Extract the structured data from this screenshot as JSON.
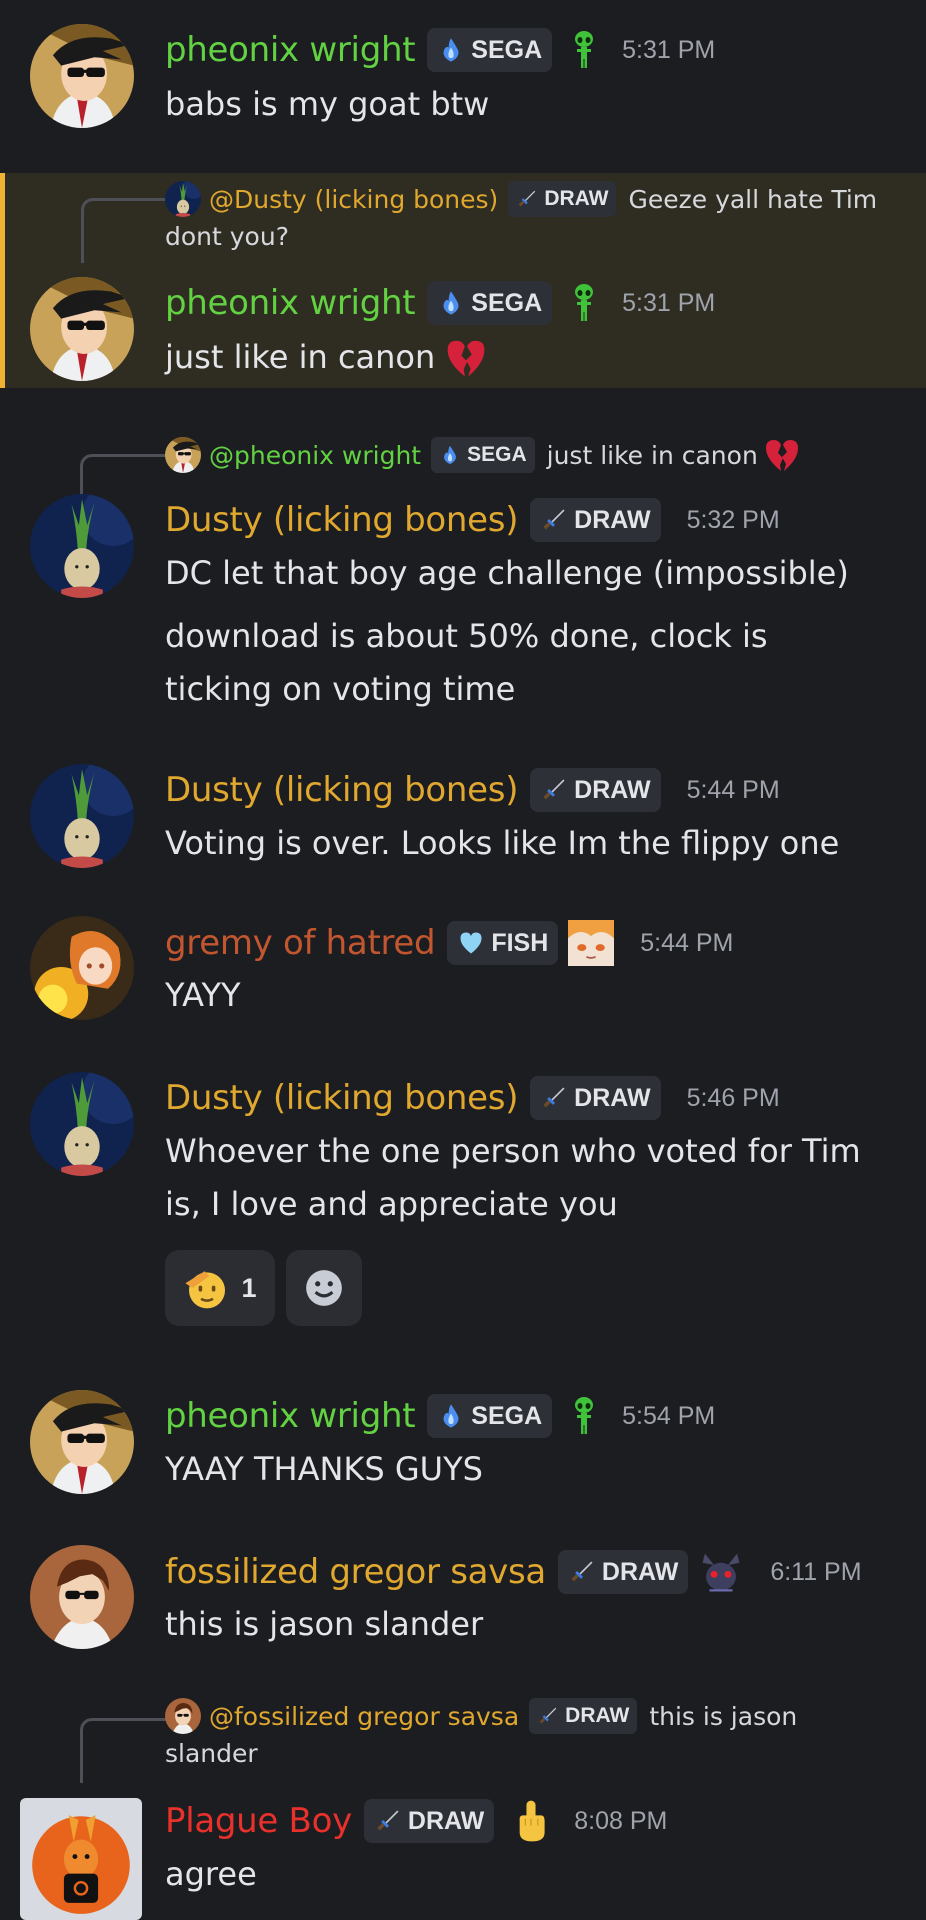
{
  "colors": {
    "pheonix": "#62d142",
    "dusty": "#e0a82e",
    "gremy": "#c2562f",
    "gregor": "#e0a82e",
    "plague": "#e8312a",
    "background": "#1c1d21"
  },
  "messages": [
    {
      "author": "pheonix wright",
      "tag": "SEGA",
      "tag_icon": "blue-flame-icon",
      "deco": "green-alien-icon",
      "time": "5:31 PM",
      "lines": [
        "babs is my goat btw"
      ]
    },
    {
      "reply": {
        "author": "@Dusty (licking bones)",
        "tag": "DRAW",
        "text": "Geeze yall hate Tim",
        "text_cont": "dont you?"
      },
      "author": "pheonix wright",
      "tag": "SEGA",
      "tag_icon": "blue-flame-icon",
      "deco": "green-alien-icon",
      "time": "5:31 PM",
      "lines": [
        "just like in canon"
      ],
      "emoji": "broken-heart-icon"
    },
    {
      "reply": {
        "author": "@pheonix wright",
        "tag": "SEGA",
        "text": "just like in canon"
      },
      "author": "Dusty (licking bones)",
      "tag": "DRAW",
      "tag_icon": "sword-icon",
      "time": "5:32 PM",
      "lines": [
        "DC let that boy age challenge (impossible)",
        "download is about 50% done, clock is",
        "ticking on voting time"
      ]
    },
    {
      "author": "Dusty (licking bones)",
      "tag": "DRAW",
      "tag_icon": "sword-icon",
      "time": "5:44 PM",
      "lines": [
        "Voting is over. Looks like Im the flippy one"
      ]
    },
    {
      "author": "gremy of hatred",
      "tag": "FISH",
      "tag_icon": "heart-icon",
      "deco": "anime-face-icon",
      "time": "5:44 PM",
      "lines": [
        "YAYY"
      ]
    },
    {
      "author": "Dusty (licking bones)",
      "tag": "DRAW",
      "tag_icon": "sword-icon",
      "time": "5:46 PM",
      "lines": [
        "Whoever the one person who voted for Tim",
        "is, I love and appreciate you"
      ],
      "reaction": {
        "emoji": "saluting-face-icon",
        "count": "1"
      },
      "add_reaction": "add-reaction-icon"
    },
    {
      "author": "pheonix wright",
      "tag": "SEGA",
      "tag_icon": "blue-flame-icon",
      "deco": "green-alien-icon",
      "time": "5:54 PM",
      "lines": [
        "YAAY THANKS GUYS"
      ]
    },
    {
      "author": "fossilized gregor savsa",
      "tag": "DRAW",
      "tag_icon": "sword-icon",
      "deco": "dark-creature-icon",
      "time": "6:11 PM",
      "lines": [
        "this is jason slander"
      ]
    },
    {
      "reply": {
        "author": "@fossilized gregor savsa",
        "tag": "DRAW",
        "text": "this is jason",
        "text_cont": "slander"
      },
      "author": "Plague Boy",
      "tag": "DRAW",
      "tag_icon": "sword-icon",
      "deco": "middle-finger-icon",
      "time": "8:08 PM",
      "lines": [
        "agree"
      ]
    }
  ]
}
